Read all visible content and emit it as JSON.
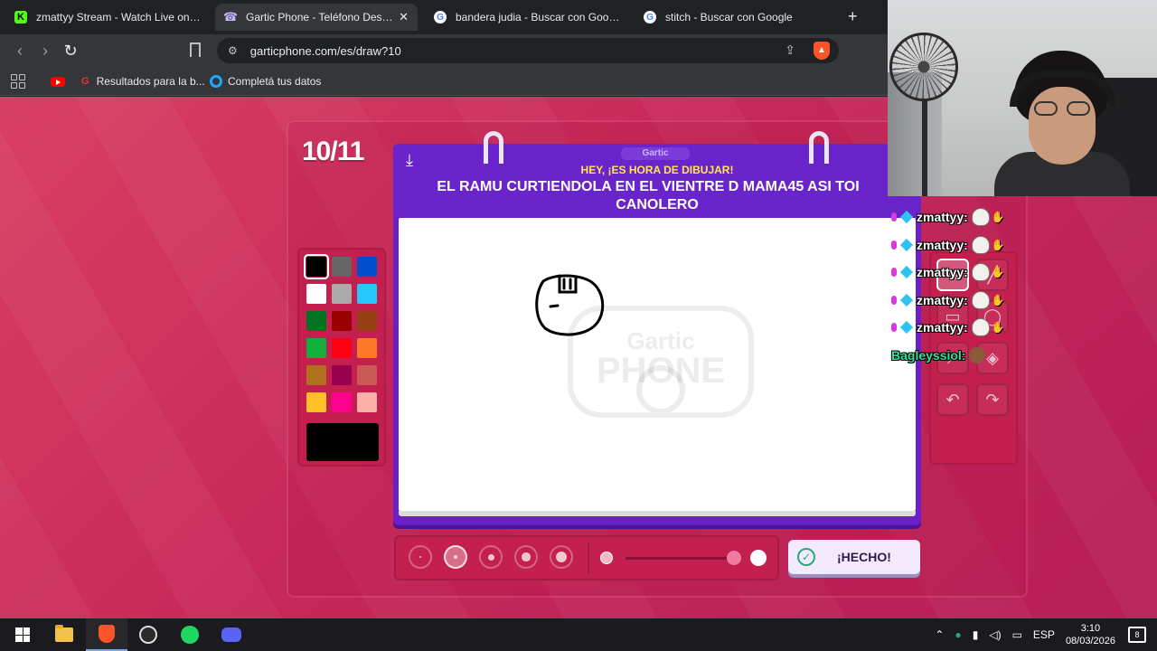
{
  "browser": {
    "tabs": [
      {
        "title": "zmattyy Stream - Watch Live on Kick",
        "favicon": "kick-icon",
        "active": false
      },
      {
        "title": "Gartic Phone - Teléfono Descom",
        "favicon": "gartic-icon",
        "active": true
      },
      {
        "title": "bandera judia - Buscar con Google",
        "favicon": "google-icon",
        "active": false
      },
      {
        "title": "stitch - Buscar con Google",
        "favicon": "google-icon",
        "active": false
      }
    ],
    "new_tab": "+",
    "url": "garticphone.com/es/draw?10",
    "bookmarks": [
      {
        "label": "Resultados para la b...",
        "icon": "results-icon"
      },
      {
        "label": "Completá tus datos",
        "icon": "ring-icon"
      }
    ]
  },
  "game": {
    "round": "10/11",
    "hey": "HEY, ¡ES HORA DE DIBUJAR!",
    "prompt_line1": "EL RAMU CURTIENDOLA EN EL VIENTRE D MAMA45 ASI TOI",
    "prompt_line2": "CANOLERO",
    "logo": "Gartic",
    "watermark_line1": "Gartic",
    "watermark_line2": "PHONE",
    "done_button": "¡HECHO!",
    "palette": [
      "#000000",
      "#666666",
      "#0050cd",
      "#ffffff",
      "#aaaaaa",
      "#26c9ff",
      "#017420",
      "#990000",
      "#964112",
      "#11b03c",
      "#ff0013",
      "#ff7829",
      "#b0701c",
      "#99004e",
      "#cb5a57",
      "#ffc126",
      "#ff008f",
      "#feafa8"
    ],
    "selected_color": "#000000",
    "brush_sizes": 5,
    "selected_brush_size": 2
  },
  "stream": {
    "chat": [
      {
        "name": "zmattyy:"
      },
      {
        "name": "zmattyy:"
      },
      {
        "name": "zmattyy:"
      },
      {
        "name": "zmattyy:"
      },
      {
        "name": "zmattyy:"
      },
      {
        "name": "Bagleyssiol:"
      }
    ]
  },
  "taskbar": {
    "language": "ESP",
    "time": "3:10",
    "date": "08/03/2026",
    "notifications": "8"
  }
}
